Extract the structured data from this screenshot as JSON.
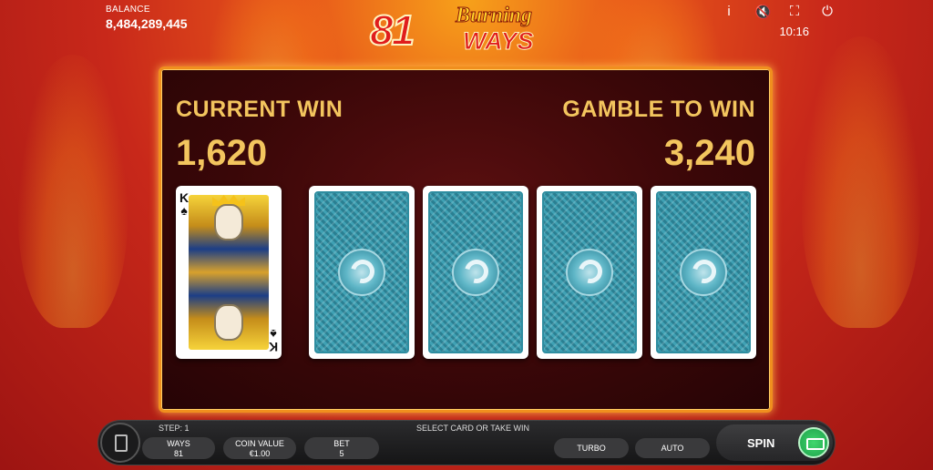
{
  "top": {
    "balance_label": "BALANCE",
    "balance_value": "8,484,289,445",
    "logo_number": "81",
    "logo_word1": "Burning",
    "logo_word2": "WAYS",
    "icons": [
      "info-icon",
      "mute-icon",
      "fullscreen-icon",
      "power-icon"
    ],
    "icon_glyphs": [
      "i",
      "🔇",
      "⛶",
      "⏻"
    ],
    "clock": "10:16"
  },
  "panel": {
    "current_win_label": "CURRENT WIN",
    "current_win_value": "1,620",
    "gamble_label": "GAMBLE TO WIN",
    "gamble_value": "3,240",
    "revealed_card": {
      "rank": "K",
      "suit": "♠"
    }
  },
  "bottom": {
    "step": "STEP: 1",
    "hint": "SELECT CARD OR TAKE WIN",
    "ways_label": "WAYS",
    "ways_value": "81",
    "coin_label": "COIN VALUE",
    "coin_value": "€1.00",
    "bet_label": "BET",
    "bet_value": "5",
    "turbo": "TURBO",
    "auto": "AUTO",
    "spin": "SPIN"
  },
  "colors": {
    "gold": "#f3c55e",
    "card_back": "#3fa1b4",
    "spin_green": "#2bc35c"
  }
}
